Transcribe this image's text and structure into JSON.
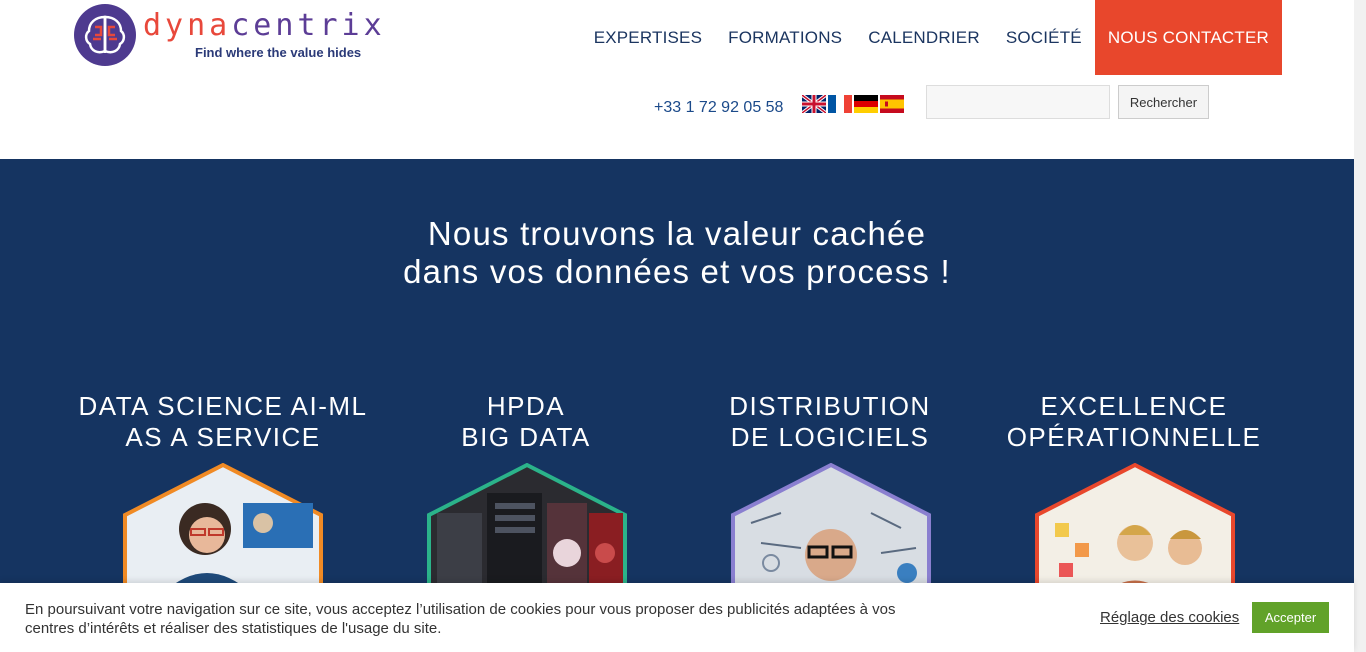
{
  "logo": {
    "word_part1": "dyna",
    "word_part2": "centrix",
    "tagline": "Find where the value hides"
  },
  "nav": {
    "items": [
      {
        "label": "EXPERTISES"
      },
      {
        "label": "FORMATIONS"
      },
      {
        "label": "CALENDRIER"
      },
      {
        "label": "SOCIÉTÉ"
      },
      {
        "label": "NOUS CONTACTER"
      }
    ]
  },
  "contact": {
    "phone": "+33 1 72 92 05 58"
  },
  "languages": [
    {
      "code": "en",
      "icon": "flag-uk-icon"
    },
    {
      "code": "fr",
      "icon": "flag-france-icon"
    },
    {
      "code": "de",
      "icon": "flag-germany-icon"
    },
    {
      "code": "es",
      "icon": "flag-spain-icon"
    }
  ],
  "search": {
    "value": "",
    "button_label": "Rechercher"
  },
  "hero": {
    "line1": "Nous trouvons la valeur cachée",
    "line2": "dans vos données et vos process !"
  },
  "services": [
    {
      "line1": "DATA SCIENCE AI-ML",
      "line2": "AS A SERVICE",
      "border_color": "#f08a24"
    },
    {
      "line1": "HPDA",
      "line2": "BIG DATA",
      "border_color": "#2bb38a"
    },
    {
      "line1": "DISTRIBUTION",
      "line2": "DE LOGICIELS",
      "border_color": "#8a7fd0"
    },
    {
      "line1": "EXCELLENCE",
      "line2": "OPÉRATIONNELLE",
      "border_color": "#e8472c"
    }
  ],
  "cookie": {
    "text": "En poursuivant votre navigation sur ce site, vous acceptez l’utilisation de cookies pour vous proposer des publicités adaptées à vos centres d’intérêts et réaliser des statistiques de l'usage du site.",
    "settings_label": "Réglage des cookies",
    "accept_label": "Accepter"
  },
  "colors": {
    "accent": "#e8472c",
    "hero_bg": "#153461",
    "nav_text": "#1b3560",
    "accept_green": "#61a229"
  }
}
